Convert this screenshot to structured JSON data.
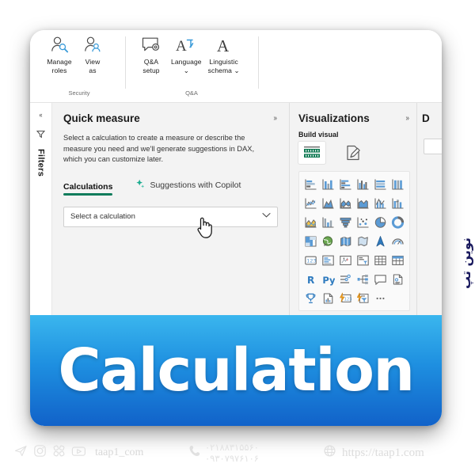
{
  "ribbon": {
    "groups": [
      {
        "caption": "Security",
        "items": [
          {
            "label_line1": "Manage",
            "label_line2": "roles",
            "icon": "manage-roles-icon"
          },
          {
            "label_line1": "View",
            "label_line2": "as",
            "icon": "view-as-icon"
          }
        ]
      },
      {
        "caption": "Q&A",
        "items": [
          {
            "label_line1": "Q&A",
            "label_line2": "setup",
            "icon": "qa-setup-icon"
          },
          {
            "label_line1": "Language",
            "label_line2": "⌄",
            "icon": "language-icon"
          },
          {
            "label_line1": "Linguistic",
            "label_line2": "schema ⌄",
            "icon": "linguistic-schema-icon"
          }
        ]
      }
    ]
  },
  "filters_rail": {
    "collapse_chevron": "«",
    "label": "Filters",
    "icon": "filter-funnel-icon"
  },
  "quick_measure": {
    "title": "Quick measure",
    "collapse_chevron": "»",
    "description": "Select a calculation to create a measure or describe the measure you need and we'll generate suggestions in DAX, which you can customize later.",
    "tabs": [
      {
        "label": "Calculations",
        "active": true
      },
      {
        "label": "Suggestions with Copilot",
        "active": false,
        "icon": "copilot-sparkle-icon"
      }
    ],
    "select": {
      "value": "Select a calculation",
      "chevron": "⌄"
    },
    "accent_color": "#107c5c"
  },
  "visualizations": {
    "title": "Visualizations",
    "collapse_chevron": "»",
    "subtitle": "Build visual",
    "builders": [
      {
        "name": "build-visual-icon",
        "selected": true
      },
      {
        "name": "format-visual-icon",
        "selected": false
      }
    ],
    "icons": [
      "stacked-bar-chart",
      "stacked-column-chart",
      "clustered-bar-chart",
      "clustered-column-chart",
      "100-stacked-bar-chart",
      "100-stacked-column-chart",
      "line-chart",
      "area-chart",
      "stacked-area-chart",
      "line-and-stacked-column-chart",
      "line-and-clustered-column-chart",
      "ribbon-chart",
      "waterfall-chart",
      "funnel-chart-col",
      "funnel-chart",
      "scatter-chart",
      "pie-chart",
      "donut-chart",
      "treemap",
      "map",
      "filled-map",
      "shape-map",
      "azure-map",
      "arc-gauge",
      "card-number",
      "multi-row-card",
      "kpi",
      "slicer",
      "table",
      "matrix",
      "r-script-visual",
      "python-visual",
      "key-influencers",
      "decomposition-tree",
      "q-and-a",
      "narrative-smart",
      "metrics",
      "paginated-report",
      "power-automate",
      "get-more-visuals",
      "more-options"
    ]
  },
  "data_pane_stub": {
    "title": "D"
  },
  "banner": {
    "text": "Calculation"
  },
  "brand_vertical": "نوین تپ",
  "footer": {
    "social_icons": [
      "telegram-icon",
      "instagram-icon",
      "aparat-icon",
      "youtube-icon"
    ],
    "handle": "taap1_com",
    "phone_icon": "phone-icon",
    "phone_numbers": [
      "۰۲۱۸۸۳۱۵۵۶۰",
      "۰۹۳۰۷۹۷۶۱۰۶"
    ],
    "globe_icon": "globe-icon",
    "website": "https://taap1.com"
  }
}
